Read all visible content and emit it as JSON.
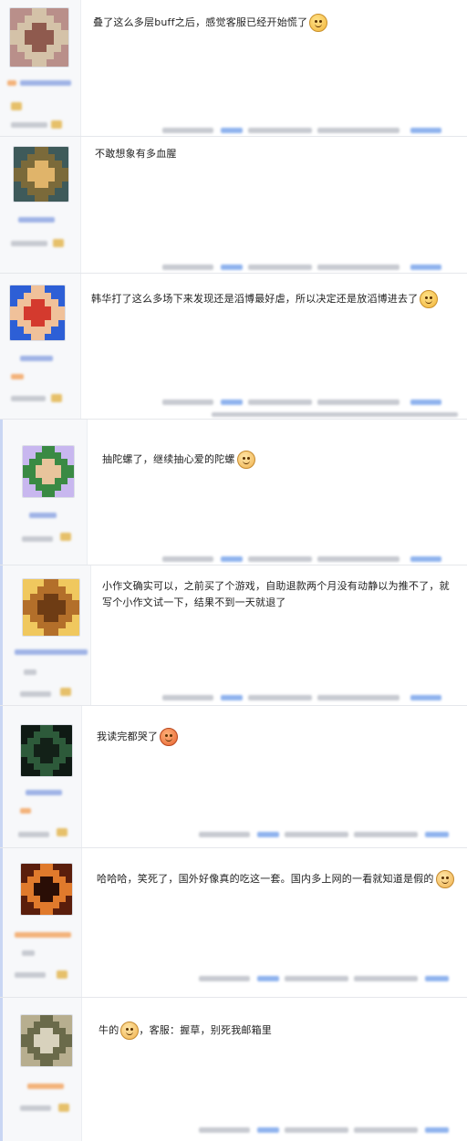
{
  "posts": [
    {
      "text": "叠了这么多层buff之后，感觉客服已经开始慌了",
      "emoji": "smile",
      "avatar_colors": [
        "#b98f8a",
        "#d4c2a8",
        "#8f5a4e"
      ]
    },
    {
      "text": "不敢想象有多血腥",
      "emoji": "",
      "avatar_colors": [
        "#3e5a5a",
        "#7b6a3a",
        "#e0b46a"
      ]
    },
    {
      "text": "韩华打了这么多场下来发现还是滔博最好虐，所以决定还是放滔博进去了",
      "emoji": "smile",
      "avatar_colors": [
        "#2d5fd6",
        "#f0c19a",
        "#d43a2e"
      ]
    },
    {
      "text": "抽陀螺了，继续抽心爱的陀螺",
      "emoji": "blush",
      "avatar_colors": [
        "#c8b7ef",
        "#3a8a44",
        "#e8c49c"
      ]
    },
    {
      "text": "小作文确实可以，之前买了个游戏，自助退款两个月没有动静以为推不了，就写个小作文试一下，结果不到一天就退了",
      "emoji": "",
      "avatar_colors": [
        "#f0c85e",
        "#b36f2a",
        "#6e3c14"
      ]
    },
    {
      "text": "我读完都哭了",
      "emoji": "angry",
      "avatar_colors": [
        "#0f1a14",
        "#2d5a3a",
        "#132118"
      ]
    },
    {
      "text": "哈哈哈，笑死了，国外好像真的吃这一套。国内多上网的一看就知道是假的",
      "emoji": "blush",
      "avatar_colors": [
        "#5a1e0c",
        "#e07a2c",
        "#2a0e06"
      ]
    },
    {
      "text_a": "牛的",
      "text_b": "，客服：握草，别死我邮箱里",
      "emoji": "blush",
      "avatar_colors": [
        "#b7ae8f",
        "#6a6a4a",
        "#d8d2bd"
      ]
    }
  ]
}
